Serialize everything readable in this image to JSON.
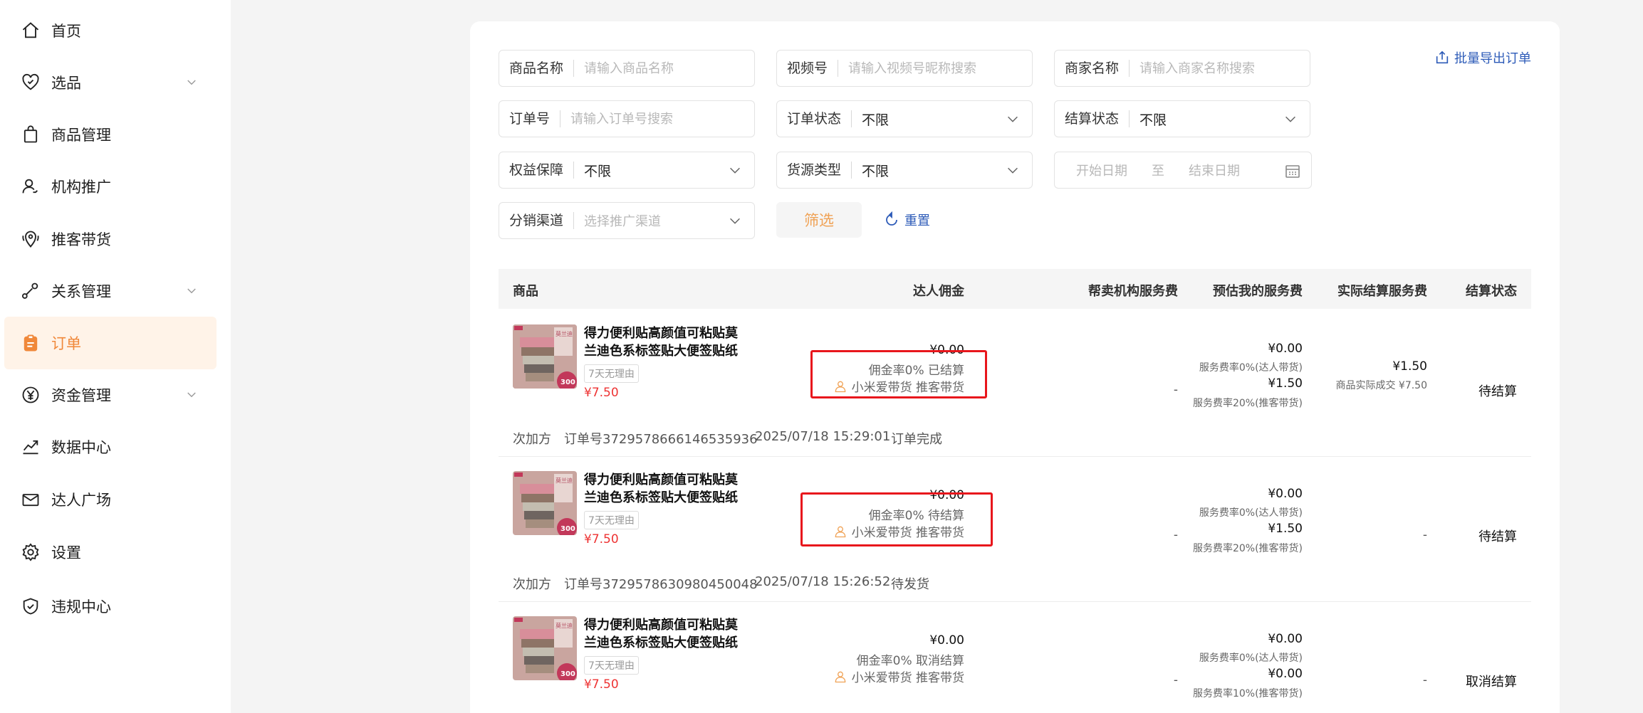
{
  "sidebar": {
    "items": [
      {
        "label": "首页",
        "icon": "home-icon"
      },
      {
        "label": "选品",
        "icon": "heart-check-icon",
        "expandable": true
      },
      {
        "label": "商品管理",
        "icon": "shopping-bag-icon"
      },
      {
        "label": "机构推广",
        "icon": "user-promo-icon"
      },
      {
        "label": "推客带货",
        "icon": "location-pin-icon"
      },
      {
        "label": "关系管理",
        "icon": "relation-icon",
        "expandable": true
      },
      {
        "label": "订单",
        "icon": "clipboard-icon",
        "active": true
      },
      {
        "label": "资金管理",
        "icon": "yen-circle-icon",
        "expandable": true
      },
      {
        "label": "数据中心",
        "icon": "trend-chart-icon"
      },
      {
        "label": "达人广场",
        "icon": "mail-check-icon"
      },
      {
        "label": "设置",
        "icon": "gear-icon"
      },
      {
        "label": "违规中心",
        "icon": "shield-check-icon"
      }
    ]
  },
  "filters": {
    "product_name": {
      "label": "商品名称",
      "placeholder": "请输入商品名称"
    },
    "video_id": {
      "label": "视频号",
      "placeholder": "请输入视频号昵称搜索"
    },
    "merchant_name": {
      "label": "商家名称",
      "placeholder": "请输入商家名称搜索"
    },
    "order_no": {
      "label": "订单号",
      "placeholder": "请输入订单号搜索"
    },
    "order_status": {
      "label": "订单状态",
      "value": "不限"
    },
    "settle_status": {
      "label": "结算状态",
      "value": "不限"
    },
    "rights": {
      "label": "权益保障",
      "value": "不限"
    },
    "source_type": {
      "label": "货源类型",
      "value": "不限"
    },
    "date_range": {
      "start": "开始日期",
      "sep": "至",
      "end": "结束日期"
    },
    "channel": {
      "label": "分销渠道",
      "placeholder": "选择推广渠道"
    },
    "filter_btn": "筛选",
    "reset_btn": "重置",
    "export_btn": "批量导出订单"
  },
  "table": {
    "headers": {
      "product": "商品",
      "commission": "达人佣金",
      "agency_fee": "帮卖机构服务费",
      "est_fee": "预估我的服务费",
      "actual_fee": "实际结算服务费",
      "settle_status": "结算状态"
    },
    "rows": [
      {
        "title": "得力便利贴高颜值可粘贴莫兰迪色系标签贴大便签贴纸学…",
        "tag": "7天无理由",
        "price": "¥7.50",
        "thumb_badge": "300",
        "thumb_label": "莫兰迪",
        "commission_amount": "¥0.00",
        "commission_desc": "佣金率0% 已结算",
        "channel_text": "小米爱带货 推客带货",
        "agency_fee": "-",
        "est_fee_1": "¥0.00",
        "est_fee_1_desc": "服务费率0%(达人带货)",
        "est_fee_2": "¥1.50",
        "est_fee_2_desc": "服务费率20%(推客带货)",
        "actual_fee": "¥1.50",
        "actual_fee_desc": "商品实际成交 ¥7.50",
        "status": "待结算"
      },
      {
        "title": "得力便利贴高颜值可粘贴莫兰迪色系标签贴大便签贴纸学…",
        "tag": "7天无理由",
        "price": "¥7.50",
        "thumb_badge": "300",
        "thumb_label": "莫兰迪",
        "commission_amount": "¥0.00",
        "commission_desc": "佣金率0% 待结算",
        "channel_text": "小米爱带货 推客带货",
        "agency_fee": "-",
        "est_fee_1": "¥0.00",
        "est_fee_1_desc": "服务费率0%(达人带货)",
        "est_fee_2": "¥1.50",
        "est_fee_2_desc": "服务费率20%(推客带货)",
        "actual_fee": "-",
        "status": "待结算"
      },
      {
        "title": "得力便利贴高颜值可粘贴莫兰迪色系标签贴大便签贴纸学…",
        "tag": "7天无理由",
        "price": "¥7.50",
        "thumb_badge": "300",
        "thumb_label": "莫兰迪",
        "commission_amount": "¥0.00",
        "commission_desc": "佣金率0% 取消结算",
        "channel_text": "小米爱带货 推客带货",
        "agency_fee": "-",
        "est_fee_1": "¥0.00",
        "est_fee_1_desc": "服务费率0%(达人带货)",
        "est_fee_2": "¥0.00",
        "est_fee_2_desc": "服务费率10%(推客带货)",
        "actual_fee": "-",
        "status": "取消结算"
      }
    ],
    "metas": [
      {
        "buyer": "次加方",
        "order_no": "订单号3729578666146535936",
        "time": "2025/07/18 15:29:01",
        "state": "订单完成"
      },
      {
        "buyer": "次加方",
        "order_no": "订单号3729578630980450048",
        "time": "2025/07/18 15:26:52",
        "state": "待发货"
      }
    ]
  },
  "colors": {
    "accent": "#f0883a",
    "active_bg": "#fff3e8",
    "link": "#2d5bb8",
    "price": "#e33333",
    "highlight": "#e8161c"
  }
}
